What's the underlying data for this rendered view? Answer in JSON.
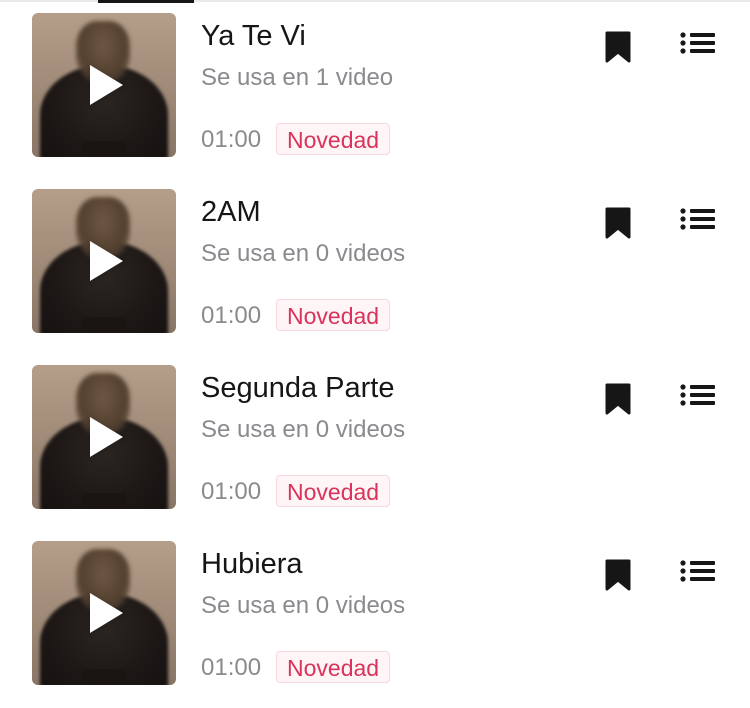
{
  "songs": [
    {
      "title": "Ya Te Vi",
      "usage": "Se usa en 1 video",
      "duration": "01:00",
      "badge": "Novedad"
    },
    {
      "title": "2AM",
      "usage": "Se usa en 0 videos",
      "duration": "01:00",
      "badge": "Novedad"
    },
    {
      "title": "Segunda Parte",
      "usage": "Se usa en 0 videos",
      "duration": "01:00",
      "badge": "Novedad"
    },
    {
      "title": "Hubiera",
      "usage": "Se usa en 0 videos",
      "duration": "01:00",
      "badge": "Novedad"
    }
  ],
  "icons": {
    "play": "play-icon",
    "bookmark": "bookmark-icon",
    "menu": "list-menu-icon"
  },
  "colors": {
    "title": "#161616",
    "secondary": "#8a8a8f",
    "badge_text": "#d9335a",
    "badge_bg": "#fff4f6"
  }
}
